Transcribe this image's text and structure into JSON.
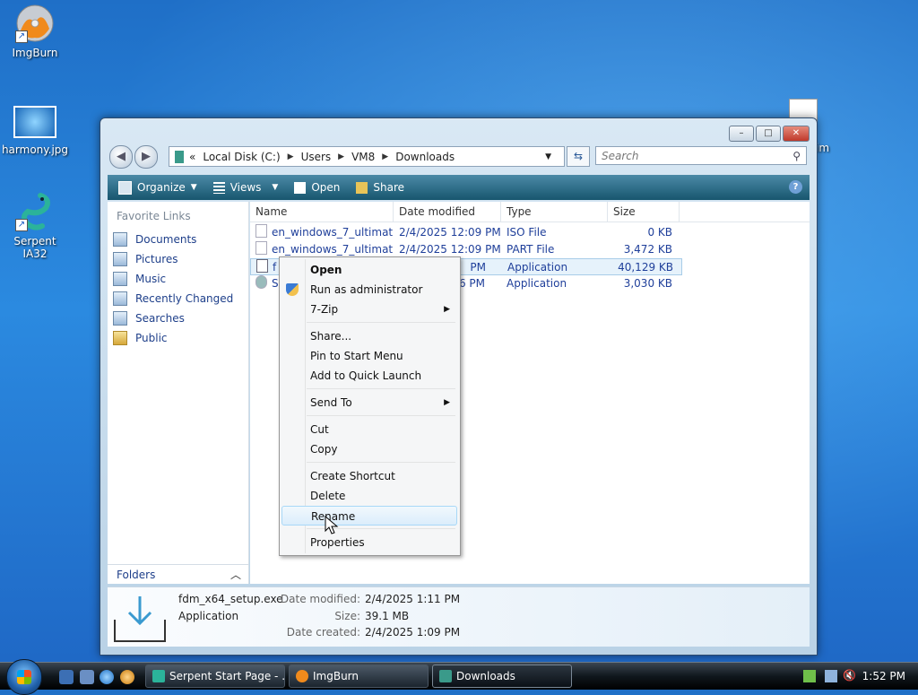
{
  "desktop": {
    "icons": [
      {
        "label": "ImgBurn"
      },
      {
        "label": "harmony.jpg"
      },
      {
        "label": "Serpent IA32"
      }
    ],
    "partial_icon_label": "im"
  },
  "window": {
    "title": "Downloads",
    "controls": {
      "minimize": "–",
      "maximize": "□",
      "close": "✕"
    },
    "address": {
      "prefix": "«",
      "crumbs": [
        "Local Disk (C:)",
        "Users",
        "VM8",
        "Downloads"
      ]
    },
    "search": {
      "placeholder": "Search"
    },
    "toolbar": {
      "organize": "Organize",
      "views": "Views",
      "open": "Open",
      "share": "Share",
      "help": "?"
    },
    "nav": {
      "heading": "Favorite Links",
      "items": [
        "Documents",
        "Pictures",
        "Music",
        "Recently Changed",
        "Searches",
        "Public"
      ],
      "folders": "Folders"
    },
    "columns": [
      "Name",
      "Date modified",
      "Type",
      "Size"
    ],
    "files": [
      {
        "name": "en_windows_7_ultimat...",
        "date": "2/4/2025 12:09 PM",
        "type": "ISO File",
        "size": "0 KB"
      },
      {
        "name": "en_windows_7_ultimat...",
        "date": "2/4/2025 12:09 PM",
        "type": "PART File",
        "size": "3,472 KB"
      },
      {
        "name": "f",
        "date": "PM",
        "type": "Application",
        "size": "40,129 KB"
      },
      {
        "name": "S",
        "date": "6 PM",
        "type": "Application",
        "size": "3,030 KB"
      }
    ],
    "details": {
      "name": "fdm_x64_setup.exe",
      "type": "Application",
      "modified_label": "Date modified:",
      "modified": "2/4/2025 1:11 PM",
      "size_label": "Size:",
      "size": "39.1 MB",
      "created_label": "Date created:",
      "created": "2/4/2025 1:09 PM"
    }
  },
  "context_menu": {
    "items": [
      "Open",
      "Run as administrator",
      "7-Zip",
      "Share...",
      "Pin to Start Menu",
      "Add to Quick Launch",
      "Send To",
      "Cut",
      "Copy",
      "Create Shortcut",
      "Delete",
      "Rename",
      "Properties"
    ],
    "hovered": "Rename"
  },
  "taskbar": {
    "tasks": [
      "Serpent Start Page - ...",
      "ImgBurn",
      "Downloads"
    ],
    "clock": "1:52 PM"
  }
}
